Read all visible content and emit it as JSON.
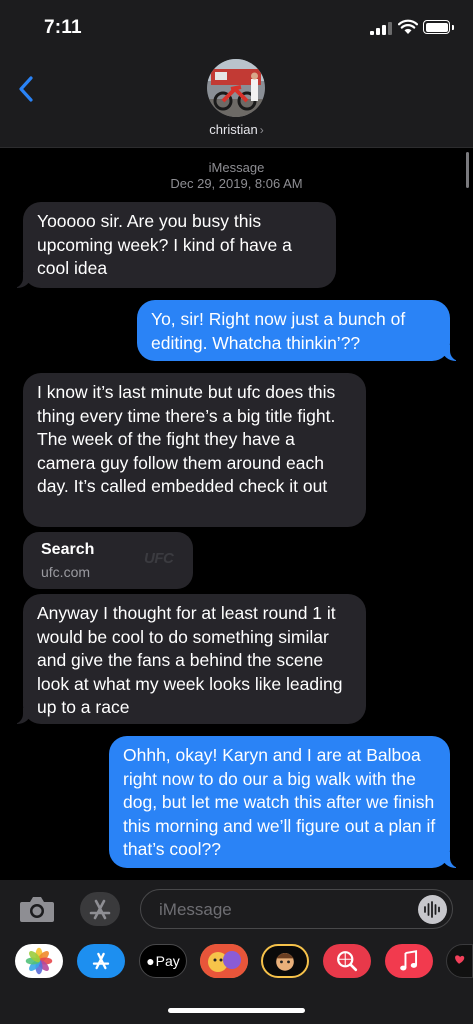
{
  "status_bar": {
    "time": "7:11"
  },
  "header": {
    "contact_name": "christian",
    "chevron": "›"
  },
  "thread": {
    "service": "iMessage",
    "timestamp": "Dec 29, 2019, 8:06 AM",
    "messages": [
      {
        "direction": "incoming",
        "text": "Yooooo sir. Are you busy this upcoming week? I kind of have a cool idea"
      },
      {
        "direction": "outgoing",
        "text": "Yo, sir! Right now just a bunch of editing. Whatcha thinkin’??"
      },
      {
        "direction": "incoming",
        "text": "I know it’s last minute but ufc does this thing every time there’s a big title fight. The week of the fight they have a camera guy follow them around each day. It’s called embedded check it out"
      },
      {
        "direction": "incoming",
        "text": "Anyway I thought for at least round 1 it would be cool to do something similar and give the fans a behind the scene look at what my week looks like leading up to a race"
      },
      {
        "direction": "outgoing",
        "text": "Ohhh, okay! Karyn and I are at Balboa right now to do our a big walk with the dog, but let me watch this after we finish this morning and we’ll figure out a plan if that’s cool??"
      }
    ],
    "link_preview": {
      "title": "Search",
      "url": "ufc.com",
      "logo_text": "UFC"
    }
  },
  "input_bar": {
    "placeholder": "iMessage"
  },
  "app_drawer": {
    "apps": [
      "photos-icon",
      "app-store-icon",
      "apple-pay-icon",
      "memoji-stickers-icon",
      "animoji-icon",
      "web-images-search-icon",
      "music-icon",
      "digital-touch-icon"
    ],
    "apple_pay_label": "Pay"
  },
  "colors": {
    "incoming_bubble": "#26252a",
    "outgoing_bubble": "#2a83f6",
    "accent": "#2a83f6",
    "background": "#000000",
    "bar": "#1c1c1e"
  }
}
